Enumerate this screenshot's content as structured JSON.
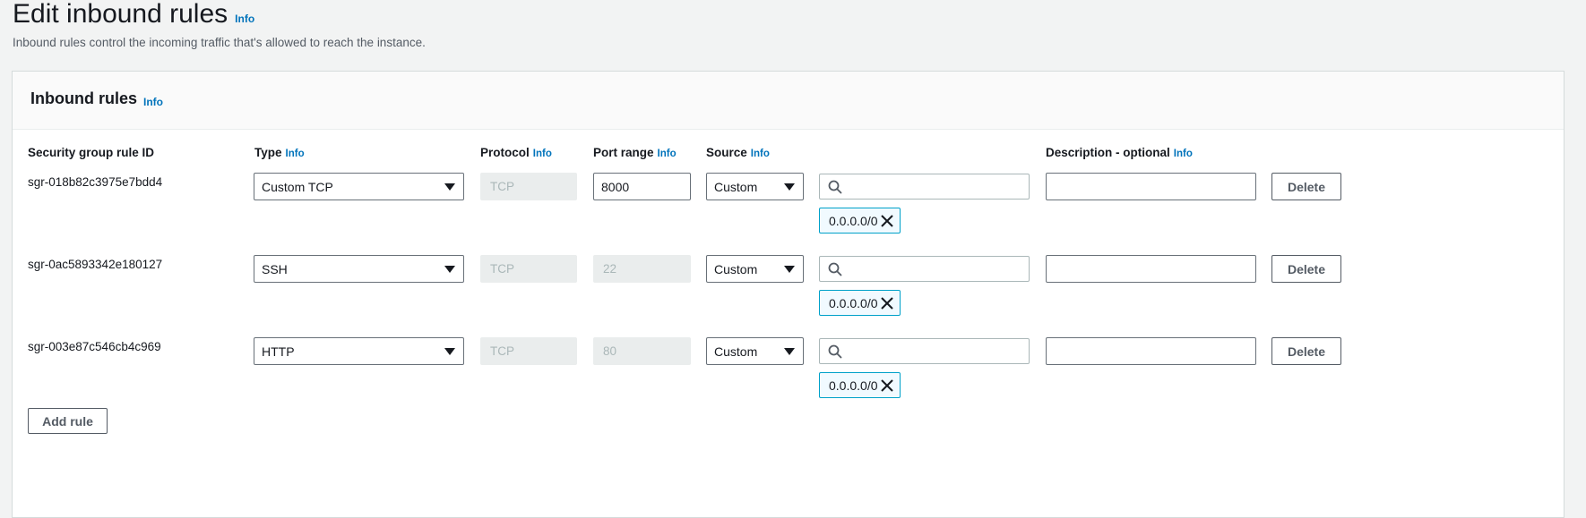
{
  "page": {
    "title": "Edit inbound rules",
    "title_info": "Info",
    "description": "Inbound rules control the incoming traffic that's allowed to reach the instance."
  },
  "panel": {
    "title": "Inbound rules",
    "title_info": "Info",
    "columns": {
      "rule_id": "Security group rule ID",
      "type": "Type",
      "protocol": "Protocol",
      "port_range": "Port range",
      "source": "Source",
      "description": "Description - optional",
      "info": "Info"
    },
    "rules": [
      {
        "id": "sgr-018b82c3975e7bdd4",
        "type": "Custom TCP",
        "protocol": "TCP",
        "port": "8000",
        "port_editable": true,
        "source": "Custom",
        "cidr": "0.0.0.0/0",
        "description": "",
        "delete_label": "Delete"
      },
      {
        "id": "sgr-0ac5893342e180127",
        "type": "SSH",
        "protocol": "TCP",
        "port": "22",
        "port_editable": false,
        "source": "Custom",
        "cidr": "0.0.0.0/0",
        "description": "",
        "delete_label": "Delete"
      },
      {
        "id": "sgr-003e87c546cb4c969",
        "type": "HTTP",
        "protocol": "TCP",
        "port": "80",
        "port_editable": false,
        "source": "Custom",
        "cidr": "0.0.0.0/0",
        "description": "",
        "delete_label": "Delete"
      }
    ],
    "add_rule_label": "Add rule"
  }
}
